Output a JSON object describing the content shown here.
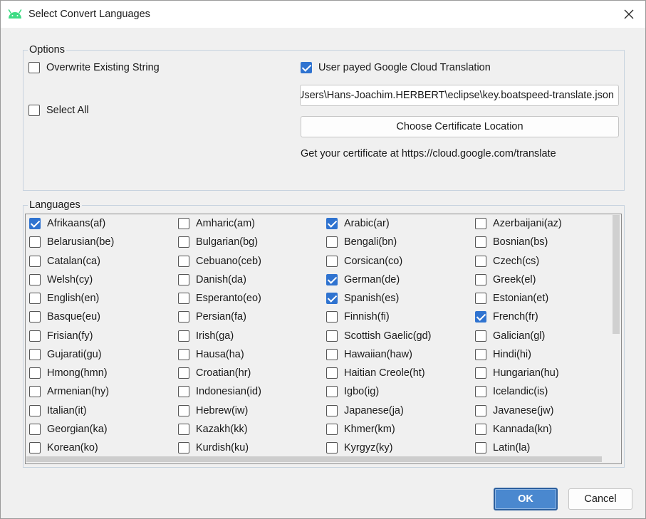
{
  "window": {
    "title": "Select Convert Languages",
    "app_icon": "android-icon",
    "close_icon": "close-icon"
  },
  "options": {
    "legend": "Options",
    "overwrite": {
      "label": "Overwrite Existing String",
      "checked": false
    },
    "select_all": {
      "label": "Select All",
      "checked": false
    },
    "google_cloud": {
      "label": "User payed Google Cloud Translation",
      "checked": true
    },
    "certificate_path": "C:\\Users\\Hans-Joachim.HERBERT\\eclipse\\key.boatspeed-translate.json",
    "choose_button": "Choose Certificate Location",
    "info": "Get your certificate at https://cloud.google.com/translate"
  },
  "languages": {
    "legend": "Languages",
    "items": [
      {
        "label": "Afrikaans(af)",
        "checked": true
      },
      {
        "label": "Amharic(am)",
        "checked": false
      },
      {
        "label": "Arabic(ar)",
        "checked": true
      },
      {
        "label": "Azerbaijani(az)",
        "checked": false
      },
      {
        "label": "Belarusian(be)",
        "checked": false
      },
      {
        "label": "Bulgarian(bg)",
        "checked": false
      },
      {
        "label": "Bengali(bn)",
        "checked": false
      },
      {
        "label": "Bosnian(bs)",
        "checked": false
      },
      {
        "label": "Catalan(ca)",
        "checked": false
      },
      {
        "label": "Cebuano(ceb)",
        "checked": false
      },
      {
        "label": "Corsican(co)",
        "checked": false
      },
      {
        "label": "Czech(cs)",
        "checked": false
      },
      {
        "label": "Welsh(cy)",
        "checked": false
      },
      {
        "label": "Danish(da)",
        "checked": false
      },
      {
        "label": "German(de)",
        "checked": true
      },
      {
        "label": "Greek(el)",
        "checked": false
      },
      {
        "label": "English(en)",
        "checked": false
      },
      {
        "label": "Esperanto(eo)",
        "checked": false
      },
      {
        "label": "Spanish(es)",
        "checked": true
      },
      {
        "label": "Estonian(et)",
        "checked": false
      },
      {
        "label": "Basque(eu)",
        "checked": false
      },
      {
        "label": "Persian(fa)",
        "checked": false
      },
      {
        "label": "Finnish(fi)",
        "checked": false
      },
      {
        "label": "French(fr)",
        "checked": true
      },
      {
        "label": "Frisian(fy)",
        "checked": false
      },
      {
        "label": "Irish(ga)",
        "checked": false
      },
      {
        "label": "Scottish Gaelic(gd)",
        "checked": false
      },
      {
        "label": "Galician(gl)",
        "checked": false
      },
      {
        "label": "Gujarati(gu)",
        "checked": false
      },
      {
        "label": "Hausa(ha)",
        "checked": false
      },
      {
        "label": "Hawaiian(haw)",
        "checked": false
      },
      {
        "label": "Hindi(hi)",
        "checked": false
      },
      {
        "label": "Hmong(hmn)",
        "checked": false
      },
      {
        "label": "Croatian(hr)",
        "checked": false
      },
      {
        "label": "Haitian Creole(ht)",
        "checked": false
      },
      {
        "label": "Hungarian(hu)",
        "checked": false
      },
      {
        "label": "Armenian(hy)",
        "checked": false
      },
      {
        "label": "Indonesian(id)",
        "checked": false
      },
      {
        "label": "Igbo(ig)",
        "checked": false
      },
      {
        "label": "Icelandic(is)",
        "checked": false
      },
      {
        "label": "Italian(it)",
        "checked": false
      },
      {
        "label": "Hebrew(iw)",
        "checked": false
      },
      {
        "label": "Japanese(ja)",
        "checked": false
      },
      {
        "label": "Javanese(jw)",
        "checked": false
      },
      {
        "label": "Georgian(ka)",
        "checked": false
      },
      {
        "label": "Kazakh(kk)",
        "checked": false
      },
      {
        "label": "Khmer(km)",
        "checked": false
      },
      {
        "label": "Kannada(kn)",
        "checked": false
      },
      {
        "label": "Korean(ko)",
        "checked": false
      },
      {
        "label": "Kurdish(ku)",
        "checked": false
      },
      {
        "label": "Kyrgyz(ky)",
        "checked": false
      },
      {
        "label": "Latin(la)",
        "checked": false
      }
    ]
  },
  "buttons": {
    "ok": "OK",
    "cancel": "Cancel"
  },
  "colors": {
    "accent": "#2f73d0",
    "ok_button": "#4a88cf",
    "android_green": "#3ddc84"
  }
}
